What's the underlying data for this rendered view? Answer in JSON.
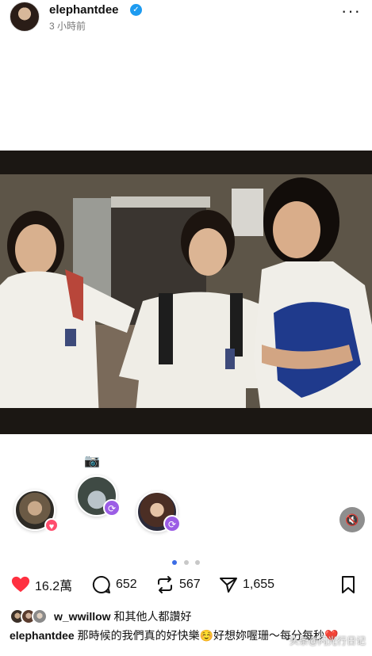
{
  "post": {
    "username": "elephantdee",
    "verified": true,
    "time": "3 小時前",
    "more_icon": "more-icon"
  },
  "carousel": {
    "total": 3,
    "current": 1
  },
  "stats": {
    "likes": "16.2萬",
    "comments": "652",
    "reposts": "567",
    "shares": "1,655"
  },
  "likers": {
    "name": "w_wwillow",
    "suffix": "和其他人都讚好"
  },
  "caption": {
    "username": "elephantdee",
    "text": "那時候的我們真的好快樂☺️好想妳喔珊～每分每秒❤️"
  },
  "watermark": "头条@闪光行日记",
  "colors": {
    "like": "#ff3040",
    "repost_badge": "#9b5de5",
    "active_dot": "#3c6de5"
  }
}
